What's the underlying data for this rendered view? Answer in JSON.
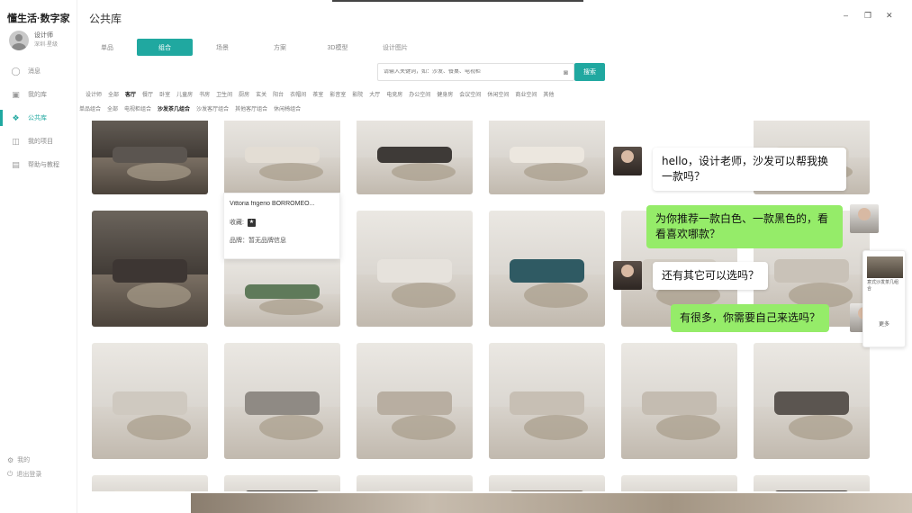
{
  "app": {
    "brand": "懂生活·数字家",
    "page_title": "公共库",
    "user_name": "设计师",
    "user_sub": "深圳·星级"
  },
  "window": {
    "minimize": "–",
    "maximize": "❐",
    "close": "✕"
  },
  "sidebar": {
    "items": [
      {
        "label": "消息",
        "icon": "message-icon"
      },
      {
        "label": "我的库",
        "icon": "library-icon"
      },
      {
        "label": "公共库",
        "icon": "public-library-icon",
        "active": true
      },
      {
        "label": "我的项目",
        "icon": "project-icon"
      },
      {
        "label": "帮助与教程",
        "icon": "help-icon"
      }
    ],
    "bottom": [
      {
        "label": "我的",
        "icon": "settings-icon"
      },
      {
        "label": "退出登录",
        "icon": "logout-icon"
      }
    ]
  },
  "tabs": [
    {
      "label": "单品"
    },
    {
      "label": "组合",
      "active": true
    },
    {
      "label": "场景"
    },
    {
      "label": "方案"
    },
    {
      "label": "3D模型"
    },
    {
      "label": "设计图片"
    }
  ],
  "search": {
    "placeholder": "请输入关键词，如：沙发、餐桌、电视柜",
    "button": "搜索"
  },
  "filters_row1": [
    "设计师",
    "全部",
    "客厅",
    "餐厅",
    "卧室",
    "儿童房",
    "书房",
    "卫生间",
    "厨房",
    "玄关",
    "阳台",
    "衣帽间",
    "茶室",
    "影音室",
    "影院",
    "大厅",
    "电竞房",
    "办公空间",
    "健身房",
    "会议空间",
    "休闲空间",
    "商业空间",
    "其他"
  ],
  "filters_row1_selected": "客厅",
  "filters_row2": [
    "单品组合",
    "全部",
    "电视柜组合",
    "沙发茶几组合",
    "沙发客厅组合",
    "其他客厅组合",
    "休闲椅组合"
  ],
  "filters_row2_selected": "沙发茶几组合",
  "info_popup": {
    "title": "Vittoria frigerio BORROMEO...",
    "collect_label": "收藏:",
    "brand_label": "品牌：",
    "brand_value": "暂无品牌信息"
  },
  "chat": {
    "messages": [
      {
        "from": "client",
        "text": "hello，设计老师，沙发可以帮我换一款吗？"
      },
      {
        "from": "designer",
        "text": "为你推荐一款白色、一款黑色的，看看喜欢哪款？"
      },
      {
        "from": "client",
        "text": "还有其它可以选吗？"
      },
      {
        "from": "designer",
        "text": "有很多，你需要自己来选吗？"
      }
    ]
  },
  "mini_card": {
    "caption": "意式沙发茶几组合",
    "more": "更多"
  },
  "colors": {
    "accent": "#20a8a0",
    "bubble_green": "#95ec69"
  }
}
